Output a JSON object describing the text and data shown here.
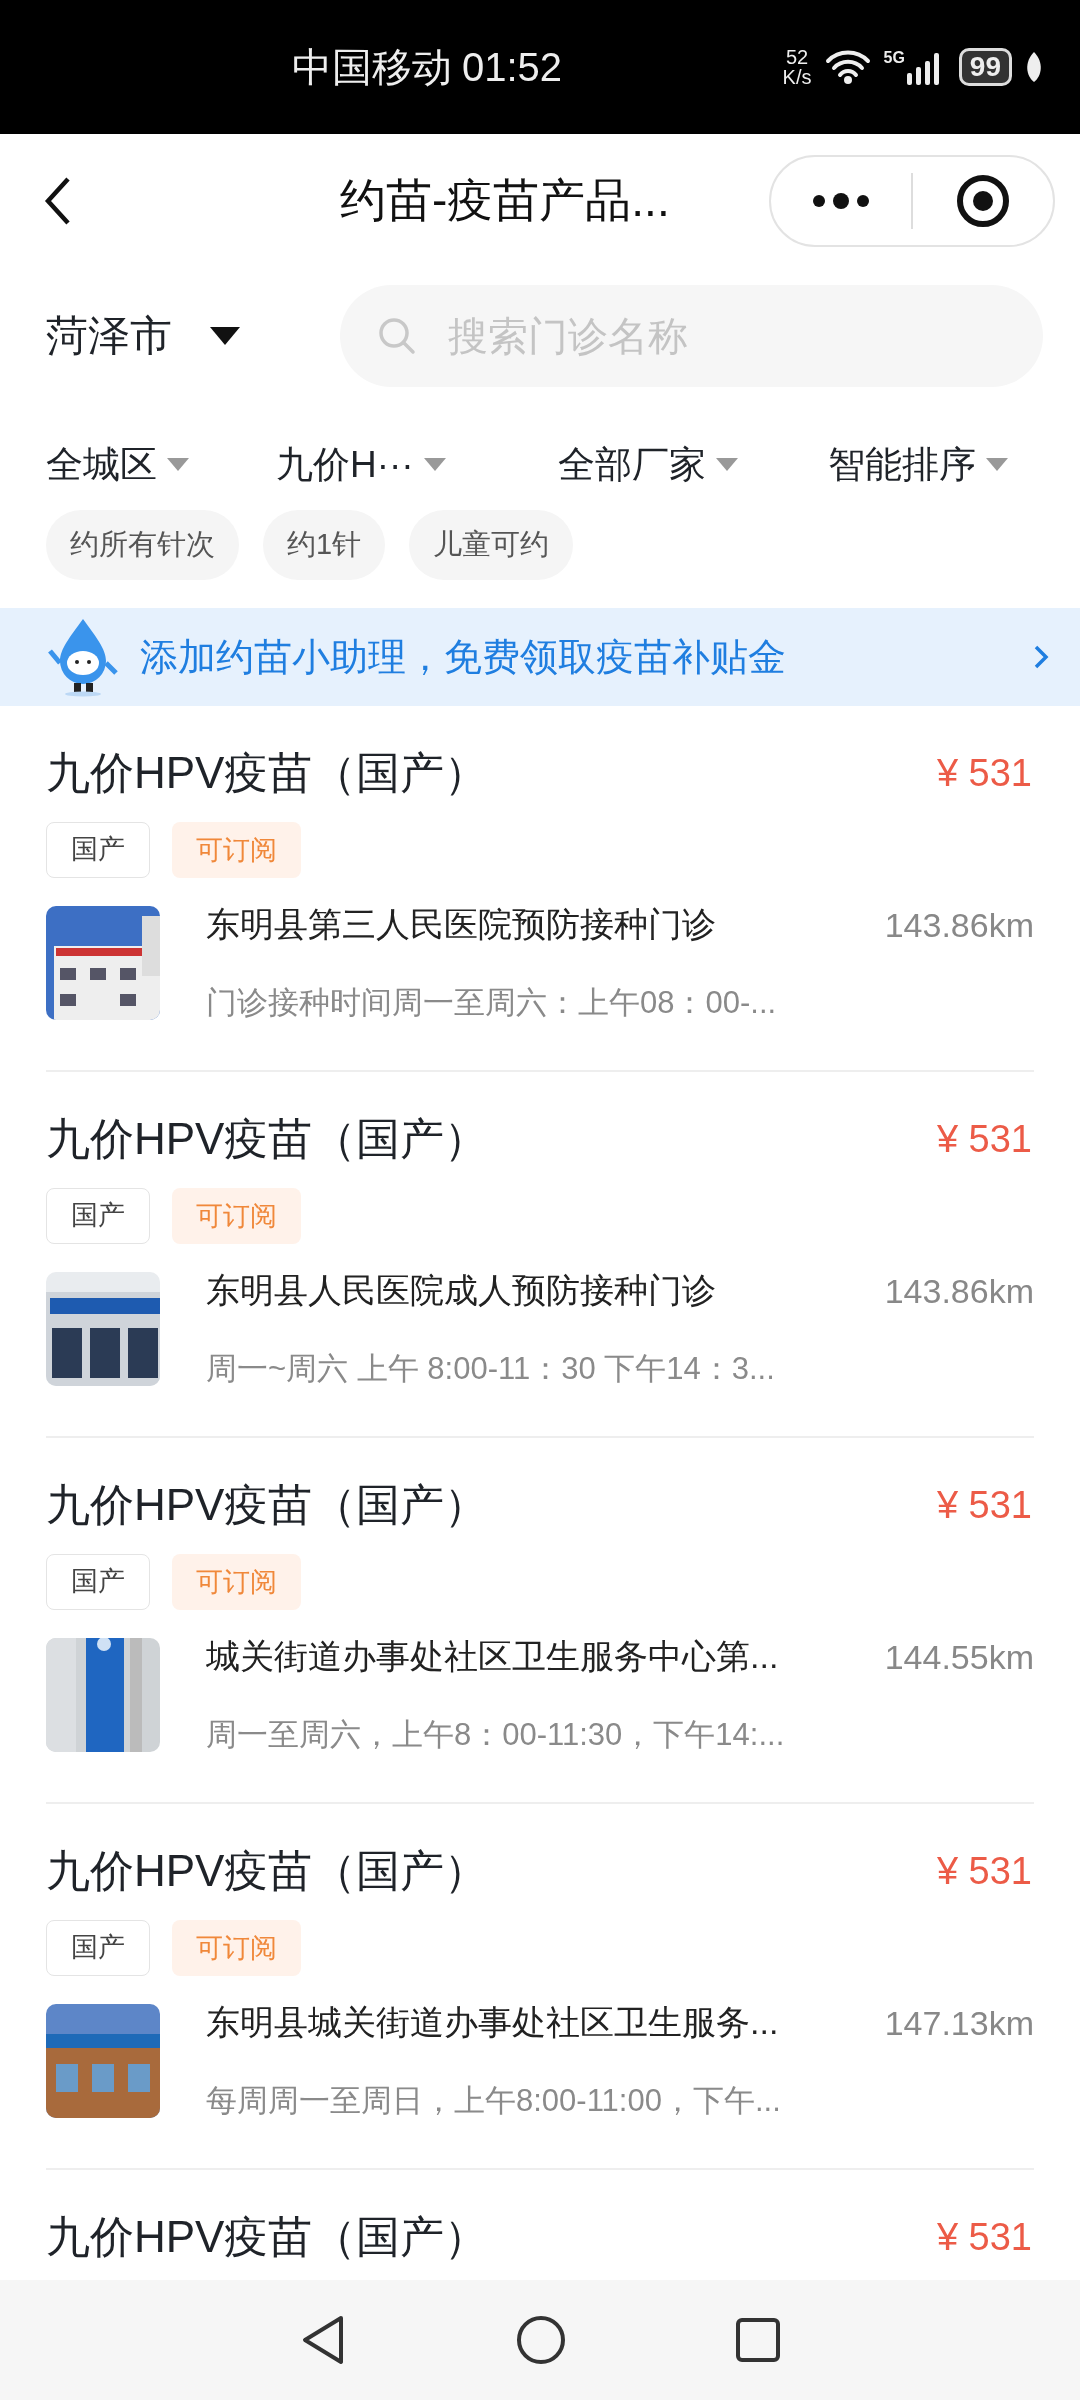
{
  "status_bar": {
    "carrier": "中国移动",
    "time": "01:52",
    "speed": "52",
    "speed_unit": "K/s",
    "network": "5G",
    "battery": "99"
  },
  "header": {
    "title": "约苗-疫苗产品..."
  },
  "location": {
    "city": "菏泽市"
  },
  "search": {
    "placeholder": "搜索门诊名称"
  },
  "filters": [
    {
      "label": "全城区"
    },
    {
      "label": "九价H···"
    },
    {
      "label": "全部厂家"
    },
    {
      "label": "智能排序"
    }
  ],
  "chips": [
    {
      "label": "约所有针次",
      "selected": false
    },
    {
      "label": "约1针",
      "selected": false
    },
    {
      "label": "儿童可约",
      "selected": false
    }
  ],
  "banner": {
    "text": "添加约苗小助理，免费领取疫苗补贴金"
  },
  "products": [
    {
      "name": "九价HPV疫苗（国产）",
      "price": "¥ 531",
      "tags": [
        {
          "label": "国产",
          "kind": "origin"
        },
        {
          "label": "可订阅",
          "kind": "subscribe"
        }
      ],
      "clinic": {
        "name": "东明县第三人民医院预防接种门诊",
        "hours": "门诊接种时间周一至周六：上午08：00-...",
        "distance": "143.86km"
      }
    },
    {
      "name": "九价HPV疫苗（国产）",
      "price": "¥ 531",
      "tags": [
        {
          "label": "国产",
          "kind": "origin"
        },
        {
          "label": "可订阅",
          "kind": "subscribe"
        }
      ],
      "clinic": {
        "name": "东明县人民医院成人预防接种门诊",
        "hours": "周一~周六 上午 8:00-11：30 下午14：3...",
        "distance": "143.86km"
      }
    },
    {
      "name": "九价HPV疫苗（国产）",
      "price": "¥ 531",
      "tags": [
        {
          "label": "国产",
          "kind": "origin"
        },
        {
          "label": "可订阅",
          "kind": "subscribe"
        }
      ],
      "clinic": {
        "name": "城关街道办事处社区卫生服务中心第...",
        "hours": "周一至周六，上午8：00-11:30，下午14:...",
        "distance": "144.55km"
      }
    },
    {
      "name": "九价HPV疫苗（国产）",
      "price": "¥ 531",
      "tags": [
        {
          "label": "国产",
          "kind": "origin"
        },
        {
          "label": "可订阅",
          "kind": "subscribe"
        }
      ],
      "clinic": {
        "name": "东明县城关街道办事处社区卫生服务...",
        "hours": "每周周一至周日，上午8:00-11:00，下午...",
        "distance": "147.13km"
      }
    },
    {
      "name": "九价HPV疫苗（国产）",
      "price": "¥ 531"
    }
  ]
}
